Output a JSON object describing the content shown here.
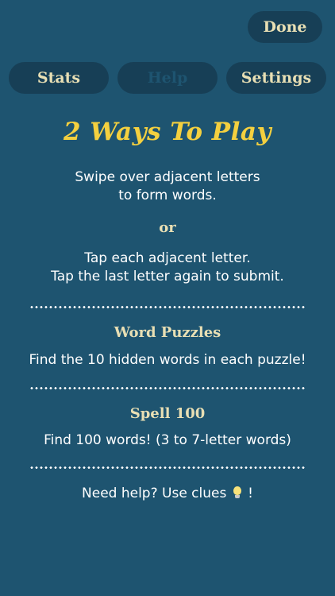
{
  "header": {
    "done_label": "Done"
  },
  "tabs": [
    {
      "label": "Stats",
      "active": false
    },
    {
      "label": "Help",
      "active": true
    },
    {
      "label": "Settings",
      "active": false
    }
  ],
  "help": {
    "title": "2 Ways To Play",
    "swipe_line1": "Swipe over adjacent letters",
    "swipe_line2": "to form words.",
    "or_label": "or",
    "tap_line1": "Tap each adjacent letter.",
    "tap_line2": "Tap the last letter again to submit.",
    "word_puzzles": {
      "title": "Word Puzzles",
      "description": "Find the 10 hidden words in each puzzle!"
    },
    "spell100": {
      "title": "Spell 100",
      "description": "Find 100 words! (3 to 7-letter words)"
    },
    "clues_prefix": "Need help? Use clues",
    "clues_suffix": "!",
    "clues_icon": "lightbulb-icon"
  },
  "colors": {
    "background": "#1e5470",
    "pill": "#173f56",
    "pill_text": "#e8dfb4",
    "title": "#f4d03f"
  }
}
